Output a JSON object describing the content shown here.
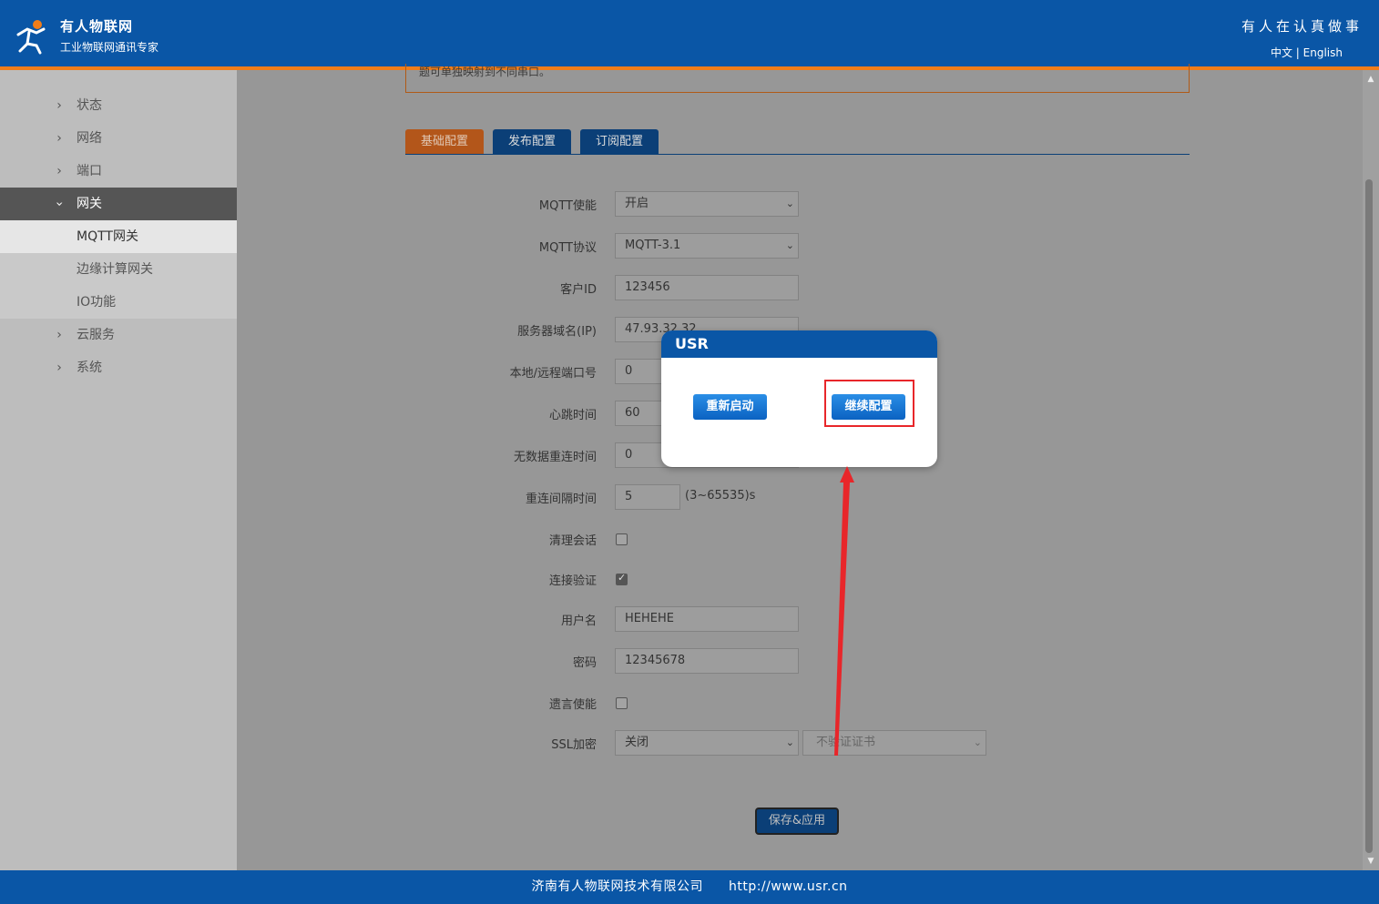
{
  "header": {
    "brand_name": "有人物联网",
    "brand_sub": "工业物联网通讯专家",
    "slogan": "有人在认真做事",
    "lang_zh": "中文",
    "lang_sep": " | ",
    "lang_en": "English"
  },
  "sidebar": {
    "items": [
      {
        "label": "状态"
      },
      {
        "label": "网络"
      },
      {
        "label": "端口"
      },
      {
        "label": "网关"
      },
      {
        "label": "云服务"
      },
      {
        "label": "系统"
      }
    ],
    "sub_items": [
      {
        "label": "MQTT网关"
      },
      {
        "label": "边缘计算网关"
      },
      {
        "label": "IO功能"
      }
    ]
  },
  "notice": {
    "text": "题可单独映射到不同串口。"
  },
  "tabs": [
    {
      "label": "基础配置"
    },
    {
      "label": "发布配置"
    },
    {
      "label": "订阅配置"
    }
  ],
  "form": {
    "mqtt_enable": {
      "label": "MQTT使能",
      "value": "开启"
    },
    "mqtt_protocol": {
      "label": "MQTT协议",
      "value": "MQTT-3.1"
    },
    "client_id": {
      "label": "客户ID",
      "value": "123456"
    },
    "server": {
      "label": "服务器域名(IP)",
      "value": "47.93.32.32"
    },
    "port": {
      "label": "本地/远程端口号",
      "value": "0"
    },
    "heartbeat": {
      "label": "心跳时间",
      "value": "60"
    },
    "no_data_reconnect": {
      "label": "无数据重连时间",
      "value": "0"
    },
    "reconnect_interval": {
      "label": "重连间隔时间",
      "value": "5",
      "hint": "(3~65535)s"
    },
    "clean_session": {
      "label": "清理会话",
      "checked": false
    },
    "conn_auth": {
      "label": "连接验证",
      "checked": true
    },
    "username": {
      "label": "用户名",
      "value": "HEHEHE"
    },
    "password": {
      "label": "密码",
      "value": "12345678"
    },
    "will_enable": {
      "label": "遗言使能",
      "checked": false
    },
    "ssl": {
      "label": "SSL加密",
      "value": "关闭",
      "cert_value": "不验证证书"
    }
  },
  "save_label": "保存&应用",
  "footer": {
    "company": "济南有人物联网技术有限公司",
    "url": "http://www.usr.cn"
  },
  "dialog": {
    "title": "USR",
    "restart_label": "重新启动",
    "continue_label": "继续配置"
  },
  "colors": {
    "header_bg": "#0a56a6",
    "accent_orange": "#f07d1a",
    "annotation_red": "#e8262a"
  }
}
